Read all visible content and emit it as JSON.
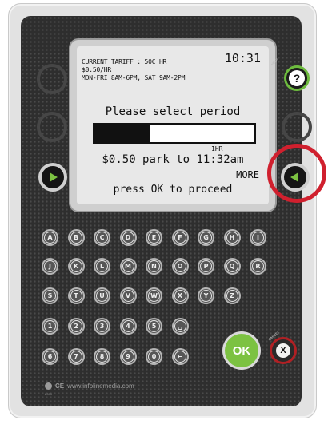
{
  "display": {
    "tariff_line1": "CURRENT TARIFF : 50C HR",
    "tariff_line2": "$0.50/HR",
    "tariff_line3": "MON-FRI 8AM-6PM, SAT 9AM-2PM",
    "time": "10:31",
    "prompt": "Please select period",
    "period_fraction": 0.35,
    "bar_scale_label": "1HR",
    "park_text": "$0.50 park to 11:32am",
    "more_label": "MORE",
    "proceed_text": "press OK to proceed"
  },
  "buttons": {
    "help_label": "HELP",
    "help_symbol": "?",
    "left_arrow_icon": "triangle-left-icon",
    "right_arrow_icon": "triangle-right-icon",
    "ok_label": "OK",
    "cancel_label": "CANCEL",
    "cancel_symbol": "X"
  },
  "keypad": {
    "row1": [
      "A",
      "B",
      "C",
      "D",
      "E",
      "F",
      "G",
      "H",
      "I"
    ],
    "row2": [
      "J",
      "K",
      "L",
      "M",
      "N",
      "O",
      "P",
      "Q",
      "R"
    ],
    "row3": [
      "S",
      "T",
      "U",
      "V",
      "W",
      "X",
      "Y",
      "Z"
    ],
    "row4": [
      "1",
      "2",
      "3",
      "4",
      "5",
      "␣"
    ],
    "row5": [
      "6",
      "7",
      "8",
      "9",
      "0",
      "←"
    ]
  },
  "footer": {
    "ce_mark": "CE",
    "url": "www.infolinemedia.com",
    "mark_code": "Z000"
  },
  "colors": {
    "accent_green": "#7cc242",
    "highlight_red": "#d0202e",
    "cancel_red": "#b02024"
  }
}
